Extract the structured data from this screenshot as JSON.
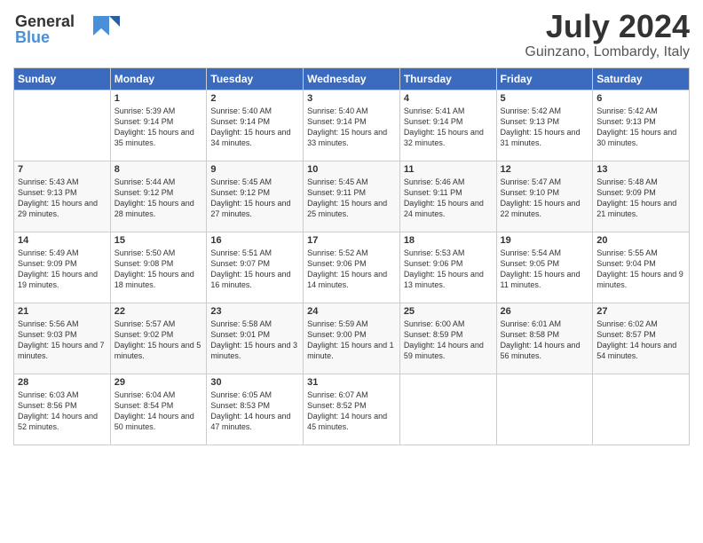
{
  "header": {
    "logo_line1": "General",
    "logo_line2": "Blue",
    "title": "July 2024",
    "location": "Guinzano, Lombardy, Italy"
  },
  "days_of_week": [
    "Sunday",
    "Monday",
    "Tuesday",
    "Wednesday",
    "Thursday",
    "Friday",
    "Saturday"
  ],
  "weeks": [
    [
      {
        "day": "",
        "sunrise": "",
        "sunset": "",
        "daylight": ""
      },
      {
        "day": "1",
        "sunrise": "Sunrise: 5:39 AM",
        "sunset": "Sunset: 9:14 PM",
        "daylight": "Daylight: 15 hours and 35 minutes."
      },
      {
        "day": "2",
        "sunrise": "Sunrise: 5:40 AM",
        "sunset": "Sunset: 9:14 PM",
        "daylight": "Daylight: 15 hours and 34 minutes."
      },
      {
        "day": "3",
        "sunrise": "Sunrise: 5:40 AM",
        "sunset": "Sunset: 9:14 PM",
        "daylight": "Daylight: 15 hours and 33 minutes."
      },
      {
        "day": "4",
        "sunrise": "Sunrise: 5:41 AM",
        "sunset": "Sunset: 9:14 PM",
        "daylight": "Daylight: 15 hours and 32 minutes."
      },
      {
        "day": "5",
        "sunrise": "Sunrise: 5:42 AM",
        "sunset": "Sunset: 9:13 PM",
        "daylight": "Daylight: 15 hours and 31 minutes."
      },
      {
        "day": "6",
        "sunrise": "Sunrise: 5:42 AM",
        "sunset": "Sunset: 9:13 PM",
        "daylight": "Daylight: 15 hours and 30 minutes."
      }
    ],
    [
      {
        "day": "7",
        "sunrise": "Sunrise: 5:43 AM",
        "sunset": "Sunset: 9:13 PM",
        "daylight": "Daylight: 15 hours and 29 minutes."
      },
      {
        "day": "8",
        "sunrise": "Sunrise: 5:44 AM",
        "sunset": "Sunset: 9:12 PM",
        "daylight": "Daylight: 15 hours and 28 minutes."
      },
      {
        "day": "9",
        "sunrise": "Sunrise: 5:45 AM",
        "sunset": "Sunset: 9:12 PM",
        "daylight": "Daylight: 15 hours and 27 minutes."
      },
      {
        "day": "10",
        "sunrise": "Sunrise: 5:45 AM",
        "sunset": "Sunset: 9:11 PM",
        "daylight": "Daylight: 15 hours and 25 minutes."
      },
      {
        "day": "11",
        "sunrise": "Sunrise: 5:46 AM",
        "sunset": "Sunset: 9:11 PM",
        "daylight": "Daylight: 15 hours and 24 minutes."
      },
      {
        "day": "12",
        "sunrise": "Sunrise: 5:47 AM",
        "sunset": "Sunset: 9:10 PM",
        "daylight": "Daylight: 15 hours and 22 minutes."
      },
      {
        "day": "13",
        "sunrise": "Sunrise: 5:48 AM",
        "sunset": "Sunset: 9:09 PM",
        "daylight": "Daylight: 15 hours and 21 minutes."
      }
    ],
    [
      {
        "day": "14",
        "sunrise": "Sunrise: 5:49 AM",
        "sunset": "Sunset: 9:09 PM",
        "daylight": "Daylight: 15 hours and 19 minutes."
      },
      {
        "day": "15",
        "sunrise": "Sunrise: 5:50 AM",
        "sunset": "Sunset: 9:08 PM",
        "daylight": "Daylight: 15 hours and 18 minutes."
      },
      {
        "day": "16",
        "sunrise": "Sunrise: 5:51 AM",
        "sunset": "Sunset: 9:07 PM",
        "daylight": "Daylight: 15 hours and 16 minutes."
      },
      {
        "day": "17",
        "sunrise": "Sunrise: 5:52 AM",
        "sunset": "Sunset: 9:06 PM",
        "daylight": "Daylight: 15 hours and 14 minutes."
      },
      {
        "day": "18",
        "sunrise": "Sunrise: 5:53 AM",
        "sunset": "Sunset: 9:06 PM",
        "daylight": "Daylight: 15 hours and 13 minutes."
      },
      {
        "day": "19",
        "sunrise": "Sunrise: 5:54 AM",
        "sunset": "Sunset: 9:05 PM",
        "daylight": "Daylight: 15 hours and 11 minutes."
      },
      {
        "day": "20",
        "sunrise": "Sunrise: 5:55 AM",
        "sunset": "Sunset: 9:04 PM",
        "daylight": "Daylight: 15 hours and 9 minutes."
      }
    ],
    [
      {
        "day": "21",
        "sunrise": "Sunrise: 5:56 AM",
        "sunset": "Sunset: 9:03 PM",
        "daylight": "Daylight: 15 hours and 7 minutes."
      },
      {
        "day": "22",
        "sunrise": "Sunrise: 5:57 AM",
        "sunset": "Sunset: 9:02 PM",
        "daylight": "Daylight: 15 hours and 5 minutes."
      },
      {
        "day": "23",
        "sunrise": "Sunrise: 5:58 AM",
        "sunset": "Sunset: 9:01 PM",
        "daylight": "Daylight: 15 hours and 3 minutes."
      },
      {
        "day": "24",
        "sunrise": "Sunrise: 5:59 AM",
        "sunset": "Sunset: 9:00 PM",
        "daylight": "Daylight: 15 hours and 1 minute."
      },
      {
        "day": "25",
        "sunrise": "Sunrise: 6:00 AM",
        "sunset": "Sunset: 8:59 PM",
        "daylight": "Daylight: 14 hours and 59 minutes."
      },
      {
        "day": "26",
        "sunrise": "Sunrise: 6:01 AM",
        "sunset": "Sunset: 8:58 PM",
        "daylight": "Daylight: 14 hours and 56 minutes."
      },
      {
        "day": "27",
        "sunrise": "Sunrise: 6:02 AM",
        "sunset": "Sunset: 8:57 PM",
        "daylight": "Daylight: 14 hours and 54 minutes."
      }
    ],
    [
      {
        "day": "28",
        "sunrise": "Sunrise: 6:03 AM",
        "sunset": "Sunset: 8:56 PM",
        "daylight": "Daylight: 14 hours and 52 minutes."
      },
      {
        "day": "29",
        "sunrise": "Sunrise: 6:04 AM",
        "sunset": "Sunset: 8:54 PM",
        "daylight": "Daylight: 14 hours and 50 minutes."
      },
      {
        "day": "30",
        "sunrise": "Sunrise: 6:05 AM",
        "sunset": "Sunset: 8:53 PM",
        "daylight": "Daylight: 14 hours and 47 minutes."
      },
      {
        "day": "31",
        "sunrise": "Sunrise: 6:07 AM",
        "sunset": "Sunset: 8:52 PM",
        "daylight": "Daylight: 14 hours and 45 minutes."
      },
      {
        "day": "",
        "sunrise": "",
        "sunset": "",
        "daylight": ""
      },
      {
        "day": "",
        "sunrise": "",
        "sunset": "",
        "daylight": ""
      },
      {
        "day": "",
        "sunrise": "",
        "sunset": "",
        "daylight": ""
      }
    ]
  ]
}
